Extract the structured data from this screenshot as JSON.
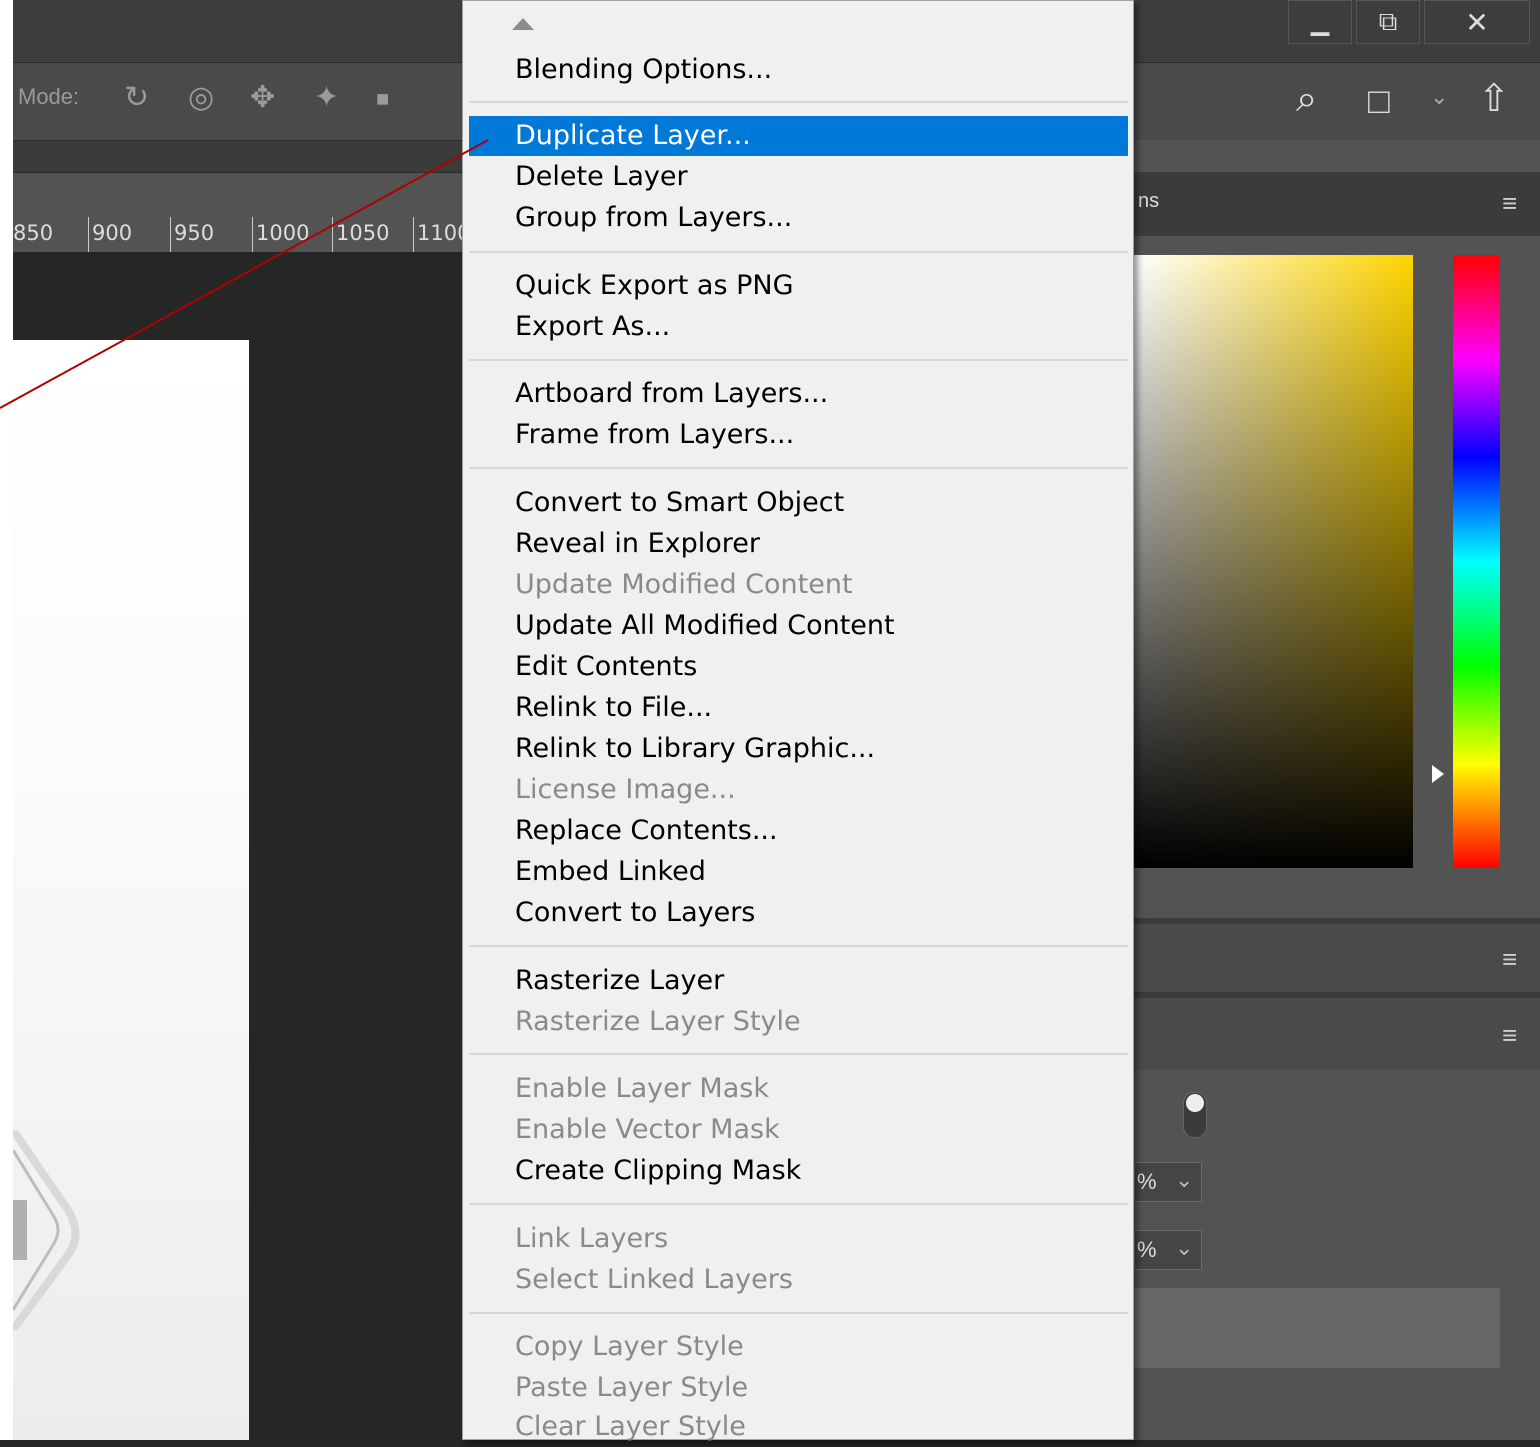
{
  "window": {
    "minimize_glyph": "▁",
    "restore_glyph": "⧉",
    "close_glyph": "✕"
  },
  "options_bar": {
    "mode_label": "Mode:",
    "tools": [
      {
        "icon": "orbit-3d-icon",
        "glyph": "↻"
      },
      {
        "icon": "roll-3d-icon",
        "glyph": "◎"
      },
      {
        "icon": "drag-3d-icon",
        "glyph": "✥"
      },
      {
        "icon": "slide-3d-icon",
        "glyph": "✦"
      },
      {
        "icon": "video-camera-icon",
        "glyph": "■"
      }
    ]
  },
  "header_icons": {
    "search_glyph": "⌕",
    "workspace_glyph": "□",
    "chevron_glyph": "⌄",
    "share_glyph": "⇧",
    "collapse_glyph": "»",
    "panel_menu_glyph": "≡"
  },
  "ruler": {
    "ticks": [
      "850",
      "900",
      "950",
      "1000",
      "1050",
      "1100"
    ]
  },
  "right_panel": {
    "tab_suffix": "ns",
    "percent_1": "%",
    "percent_2": "%"
  },
  "colors": {
    "highlight": "#0078d7",
    "menu_bg": "#f0f0f0",
    "pointer_line": "#b00000"
  },
  "context_menu": {
    "scroll_up_icon": "triangle-up-icon",
    "groups": [
      [
        {
          "label": "Blending Options...",
          "enabled": true
        }
      ],
      [
        {
          "label": "Duplicate Layer...",
          "enabled": true,
          "highlighted": true
        },
        {
          "label": "Delete Layer",
          "enabled": true
        },
        {
          "label": "Group from Layers...",
          "enabled": true
        }
      ],
      [
        {
          "label": "Quick Export as PNG",
          "enabled": true
        },
        {
          "label": "Export As...",
          "enabled": true
        }
      ],
      [
        {
          "label": "Artboard from Layers...",
          "enabled": true
        },
        {
          "label": "Frame from Layers...",
          "enabled": true
        }
      ],
      [
        {
          "label": "Convert to Smart Object",
          "enabled": true
        },
        {
          "label": "Reveal in Explorer",
          "enabled": true
        },
        {
          "label": "Update Modified Content",
          "enabled": false
        },
        {
          "label": "Update All Modified Content",
          "enabled": true
        },
        {
          "label": "Edit Contents",
          "enabled": true
        },
        {
          "label": "Relink to File...",
          "enabled": true
        },
        {
          "label": "Relink to Library Graphic...",
          "enabled": true
        },
        {
          "label": "License Image...",
          "enabled": false
        },
        {
          "label": "Replace Contents...",
          "enabled": true
        },
        {
          "label": "Embed Linked",
          "enabled": true
        },
        {
          "label": "Convert to Layers",
          "enabled": true
        }
      ],
      [
        {
          "label": "Rasterize Layer",
          "enabled": true
        },
        {
          "label": "Rasterize Layer Style",
          "enabled": false
        }
      ],
      [
        {
          "label": "Enable Layer Mask",
          "enabled": false
        },
        {
          "label": "Enable Vector Mask",
          "enabled": false
        },
        {
          "label": "Create Clipping Mask",
          "enabled": true
        }
      ],
      [
        {
          "label": "Link Layers",
          "enabled": false
        },
        {
          "label": "Select Linked Layers",
          "enabled": false
        }
      ],
      [
        {
          "label": "Copy Layer Style",
          "enabled": false
        },
        {
          "label": "Paste Layer Style",
          "enabled": false
        },
        {
          "label": "Clear Layer Style",
          "enabled": false
        }
      ]
    ]
  }
}
